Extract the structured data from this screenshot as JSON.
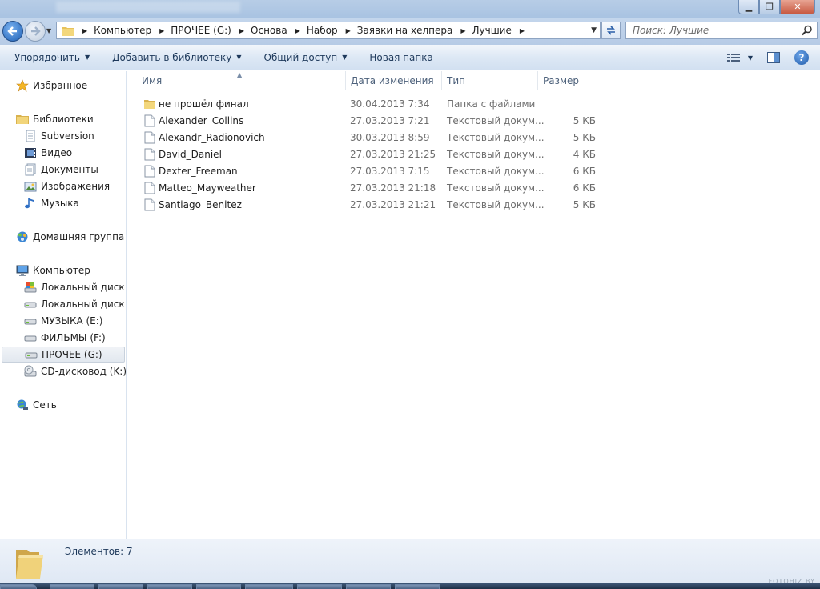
{
  "address": {
    "segments": [
      "Компьютер",
      "ПРОЧЕЕ (G:)",
      "Основа",
      "Набор",
      "Заявки на хелпера",
      "Лучшие"
    ]
  },
  "search": {
    "placeholder": "Поиск: Лучшие"
  },
  "toolbar": {
    "organize": "Упорядочить",
    "add_to_library": "Добавить в библиотеку",
    "share": "Общий доступ",
    "new_folder": "Новая папка"
  },
  "nav": {
    "favorites": "Избранное",
    "libraries": "Библиотеки",
    "library_items": [
      "Subversion",
      "Видео",
      "Документы",
      "Изображения",
      "Музыка"
    ],
    "homegroup": "Домашняя группа",
    "computer": "Компьютер",
    "drives": [
      "Локальный диск (C:)",
      "Локальный диск (D:)",
      "МУЗЫКА (E:)",
      "ФИЛЬМЫ (F:)",
      "ПРОЧЕЕ (G:)",
      "CD-дисковод (K:)"
    ],
    "network": "Сеть"
  },
  "columns": {
    "name": "Имя",
    "date": "Дата изменения",
    "type": "Тип",
    "size": "Размер"
  },
  "files": [
    {
      "name": "не прошёл финал",
      "date": "30.04.2013 7:34",
      "type": "Папка с файлами",
      "size": "",
      "icon": "folder-icon"
    },
    {
      "name": "Alexander_Collins",
      "date": "27.03.2013 7:21",
      "type": "Текстовый докум...",
      "size": "5 КБ",
      "icon": "text-file-icon"
    },
    {
      "name": "Alexandr_Radionovich",
      "date": "30.03.2013 8:59",
      "type": "Текстовый докум...",
      "size": "5 КБ",
      "icon": "text-file-icon"
    },
    {
      "name": "David_Daniel",
      "date": "27.03.2013 21:25",
      "type": "Текстовый докум...",
      "size": "4 КБ",
      "icon": "text-file-icon"
    },
    {
      "name": "Dexter_Freeman",
      "date": "27.03.2013 7:15",
      "type": "Текстовый докум...",
      "size": "6 КБ",
      "icon": "text-file-icon"
    },
    {
      "name": "Matteo_Mayweather",
      "date": "27.03.2013 21:18",
      "type": "Текстовый докум...",
      "size": "6 КБ",
      "icon": "text-file-icon"
    },
    {
      "name": "Santiago_Benitez",
      "date": "27.03.2013 21:21",
      "type": "Текстовый докум...",
      "size": "5 КБ",
      "icon": "text-file-icon"
    }
  ],
  "status": {
    "count": "Элементов: 7"
  },
  "watermark": "FOTOHIZ.BY"
}
